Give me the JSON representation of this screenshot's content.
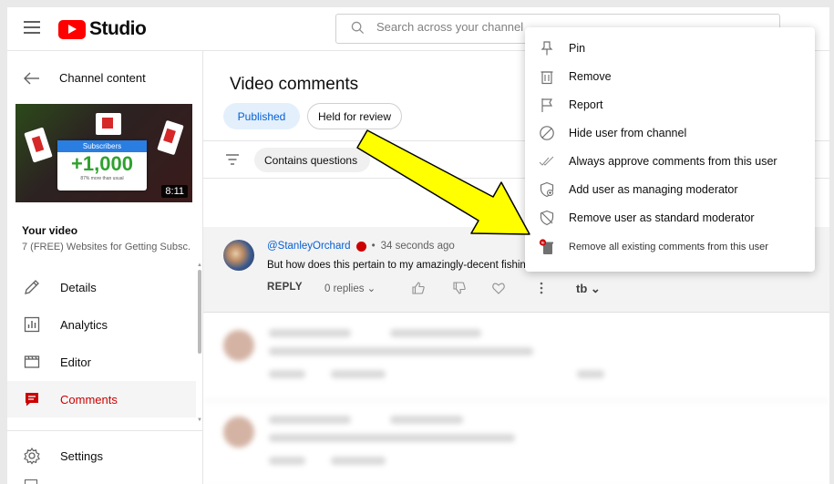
{
  "header": {
    "logo_text": "Studio",
    "search_placeholder": "Search across your channel"
  },
  "sidebar": {
    "back_label": "Channel content",
    "thumbnail": {
      "card_head": "Subscribers",
      "card_big": "+1,000",
      "card_small": "87% more than usual",
      "duration": "8:11"
    },
    "video_title": "Your video",
    "video_subtitle": "7 (FREE) Websites for Getting Subsc...",
    "items": [
      {
        "label": "Details",
        "icon": "pencil-icon"
      },
      {
        "label": "Analytics",
        "icon": "analytics-icon"
      },
      {
        "label": "Editor",
        "icon": "editor-icon"
      },
      {
        "label": "Comments",
        "icon": "comments-icon",
        "active": true
      },
      {
        "label": "Settings",
        "icon": "gear-icon"
      }
    ]
  },
  "main": {
    "title": "Video comments",
    "tabs": [
      {
        "label": "Published",
        "active": true
      },
      {
        "label": "Held for review",
        "active": false
      }
    ],
    "filter_chip": "Contains questions",
    "comment": {
      "author": "@StanleyOrchard",
      "time": "34 seconds ago",
      "separator": "•",
      "text": "But how does this pertain to my amazingly-decent fishing",
      "reply_label": "REPLY",
      "replies_label": "0 replies",
      "tb_label": "tb"
    }
  },
  "menu": {
    "items": [
      {
        "label": "Pin",
        "icon": "pin-icon"
      },
      {
        "label": "Remove",
        "icon": "trash-icon"
      },
      {
        "label": "Report",
        "icon": "flag-icon"
      },
      {
        "label": "Hide user from channel",
        "icon": "block-icon"
      },
      {
        "label": "Always approve comments from this user",
        "icon": "double-check-icon"
      },
      {
        "label": "Add user as managing moderator",
        "icon": "shield-add-icon"
      },
      {
        "label": "Remove user as standard moderator",
        "icon": "shield-remove-icon"
      },
      {
        "label": "Remove all existing comments from this user",
        "icon": "tubebuddy-trash-icon"
      }
    ]
  },
  "colors": {
    "accent_red": "#cc0000",
    "link_blue": "#065fd4",
    "arrow_yellow": "#ffff00"
  }
}
